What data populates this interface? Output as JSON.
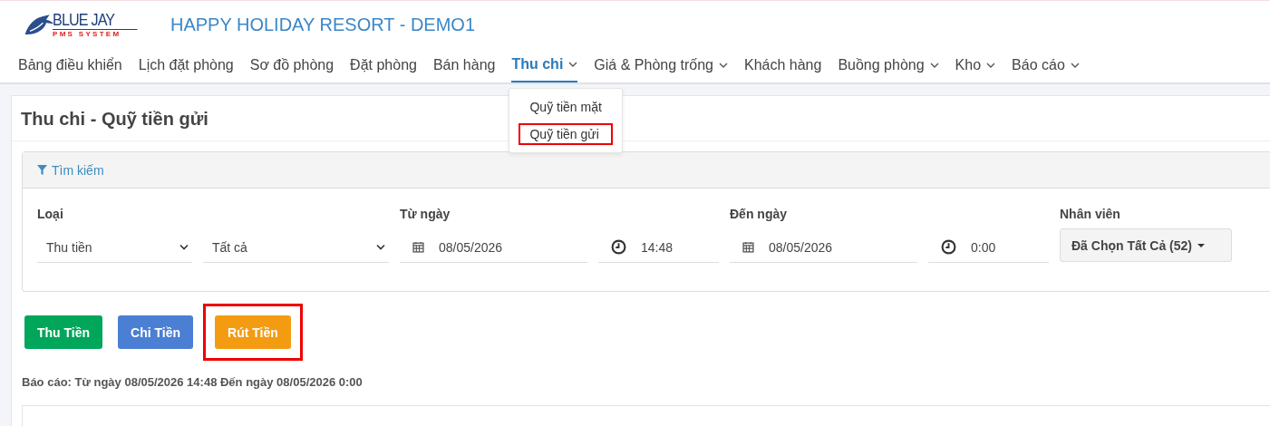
{
  "logo": {
    "name": "BLUE JAY",
    "tagline": "PMS SYSTEM"
  },
  "hotel_title": "HAPPY HOLIDAY RESORT - DEMO1",
  "nav": [
    {
      "label": "Bảng điều khiển",
      "selected": false,
      "dropdown": false
    },
    {
      "label": "Lịch đặt phòng",
      "selected": false,
      "dropdown": false
    },
    {
      "label": "Sơ đồ phòng",
      "selected": false,
      "dropdown": false
    },
    {
      "label": "Đặt phòng",
      "selected": false,
      "dropdown": false
    },
    {
      "label": "Bán hàng",
      "selected": false,
      "dropdown": false
    },
    {
      "label": "Thu chi",
      "selected": true,
      "dropdown": true
    },
    {
      "label": "Giá & Phòng trống",
      "selected": false,
      "dropdown": true
    },
    {
      "label": "Khách hàng",
      "selected": false,
      "dropdown": false
    },
    {
      "label": "Buồng phòng",
      "selected": false,
      "dropdown": true
    },
    {
      "label": "Kho",
      "selected": false,
      "dropdown": true
    },
    {
      "label": "Báo cáo",
      "selected": false,
      "dropdown": true
    }
  ],
  "dropdown_menu": [
    {
      "label": "Quỹ tiền mặt",
      "highlighted": false
    },
    {
      "label": "Quỹ tiền gửi",
      "highlighted": true
    }
  ],
  "page_title": "Thu chi - Quỹ tiền gửi",
  "search_panel": {
    "title": "Tìm kiếm",
    "fields": [
      {
        "kind": "select",
        "label": "Loại",
        "value": "Thu tiền"
      },
      {
        "kind": "select",
        "value": "Tất cả"
      },
      {
        "kind": "date",
        "label": "Từ ngày",
        "value": "08/05/2026"
      },
      {
        "kind": "time",
        "value": "14:48"
      },
      {
        "kind": "date",
        "label": "Đến ngày",
        "value": "08/05/2026"
      },
      {
        "kind": "time",
        "value": "0:00"
      },
      {
        "kind": "multiselect",
        "label": "Nhân viên",
        "value": "Đã Chọn Tất Cả (52)"
      }
    ]
  },
  "actions": [
    {
      "label": "Thu Tiền",
      "color": "#00a65a",
      "highlighted": false
    },
    {
      "label": "Chi Tiền",
      "color": "#4a7fd4",
      "highlighted": false
    },
    {
      "label": "Rút Tiền",
      "color": "#f39c12",
      "highlighted": true
    }
  ],
  "report_caption": "Báo cáo: Từ ngày 08/05/2026 14:48 Đến ngày 08/05/2026 0:00"
}
